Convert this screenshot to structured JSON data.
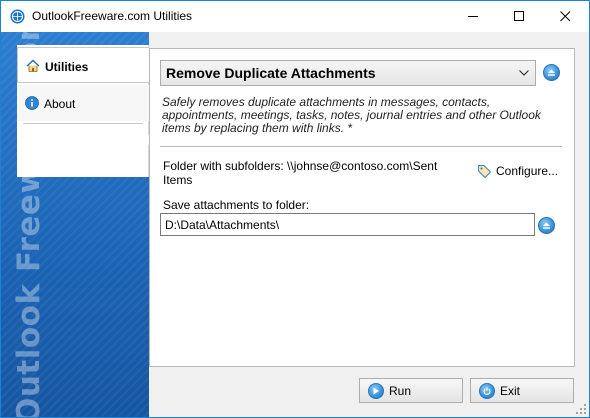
{
  "window": {
    "title": "OutlookFreeware.com Utilities"
  },
  "icons": {
    "app": "outlookfreeware-logo-icon",
    "minimize": "minimize-icon",
    "maximize": "maximize-icon",
    "close": "close-icon",
    "home": "home-icon",
    "info": "info-icon",
    "tag": "tag-icon",
    "eject": "eject-icon",
    "run": "play-icon",
    "exit": "power-icon"
  },
  "sidebar": {
    "brand_watermark": "Outlook Freeware .com",
    "items": [
      {
        "label": "Utilities",
        "selected": true
      },
      {
        "label": "About",
        "selected": false
      }
    ]
  },
  "main": {
    "utility_selected": "Remove Duplicate Attachments",
    "description": "Safely removes duplicate attachments in messages, contacts, appointments, meetings, tasks, notes, journal entries and other Outlook items by replacing them with links. *",
    "folder_label": "Folder with subfolders: \\\\johnse@contoso.com\\Sent Items",
    "configure_label": "Configure...",
    "save_label": "Save attachments to folder:",
    "save_path": "D:\\Data\\Attachments\\"
  },
  "footer": {
    "run_label": "Run",
    "exit_label": "Exit"
  },
  "colors": {
    "accent": "#1883d7",
    "sidebar_blue": "#1f66b8"
  }
}
